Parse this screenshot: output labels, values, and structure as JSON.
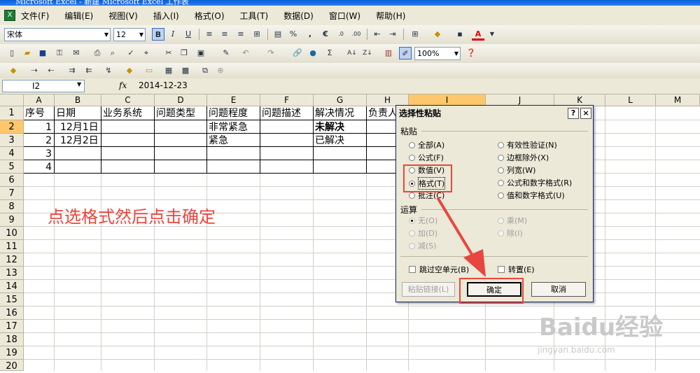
{
  "window": {
    "title": "Microsoft Excel - 新建 Microsoft Excel 工作表"
  },
  "menu": [
    "文件(F)",
    "编辑(E)",
    "视图(V)",
    "插入(I)",
    "格式(O)",
    "工具(T)",
    "数据(D)",
    "窗口(W)",
    "帮助(H)"
  ],
  "toolbar": {
    "font_name": "宋体",
    "font_size": "12",
    "bold": "B",
    "italic": "I",
    "underline": "U",
    "percent": "%",
    "comma": ",",
    "euro": "€",
    "sum": "Σ",
    "zoom": "100%"
  },
  "formula_bar": {
    "name_box": "I2",
    "fx": "fx",
    "value": "2014-12-23"
  },
  "columns": [
    "A",
    "B",
    "C",
    "D",
    "E",
    "F",
    "G",
    "H",
    "I",
    "J",
    "K",
    "L",
    "M"
  ],
  "rows": [
    "1",
    "2",
    "3",
    "4",
    "5",
    "6",
    "7",
    "8",
    "9",
    "10",
    "11",
    "12",
    "13",
    "14",
    "15",
    "16",
    "17",
    "18",
    "19",
    "20"
  ],
  "cells": {
    "headers": [
      "序号",
      "日期",
      "业务系统",
      "问题类型",
      "问题程度",
      "问题描述",
      "解决情况",
      "负责人"
    ],
    "row2": {
      "a": "1",
      "b": "12月1日",
      "e": "非常紧急",
      "g": "未解决"
    },
    "row3": {
      "a": "2",
      "b": "12月2日",
      "e": "紧急",
      "g": "已解决"
    },
    "row4": {
      "a": "3"
    },
    "row5": {
      "a": "4"
    }
  },
  "annotation": "点选格式然后点击确定",
  "dialog": {
    "title": "选择性粘贴",
    "help": "?",
    "close": "×",
    "paste_group": "粘贴",
    "paste_left": [
      "全部(A)",
      "公式(F)",
      "数值(V)",
      "格式(T)",
      "批注(C)"
    ],
    "paste_right": [
      "有效性验证(N)",
      "边框除外(X)",
      "列宽(W)",
      "公式和数字格式(R)",
      "值和数字格式(U)"
    ],
    "op_group": "运算",
    "op_left": [
      "无(O)",
      "加(D)",
      "减(S)"
    ],
    "op_right": [
      "乘(M)",
      "除(I)"
    ],
    "skip_blanks": "跳过空单元(B)",
    "transpose": "转置(E)",
    "paste_link": "粘贴链接(L)",
    "ok": "确定",
    "cancel": "取消"
  },
  "watermark": {
    "brand": "Baidu经验",
    "url": "jingyan.baidu.com"
  },
  "colors": {
    "annotation_red": "#e8473f",
    "selected_col": "#ffc76b",
    "menu_bg": "#ece9d8"
  }
}
